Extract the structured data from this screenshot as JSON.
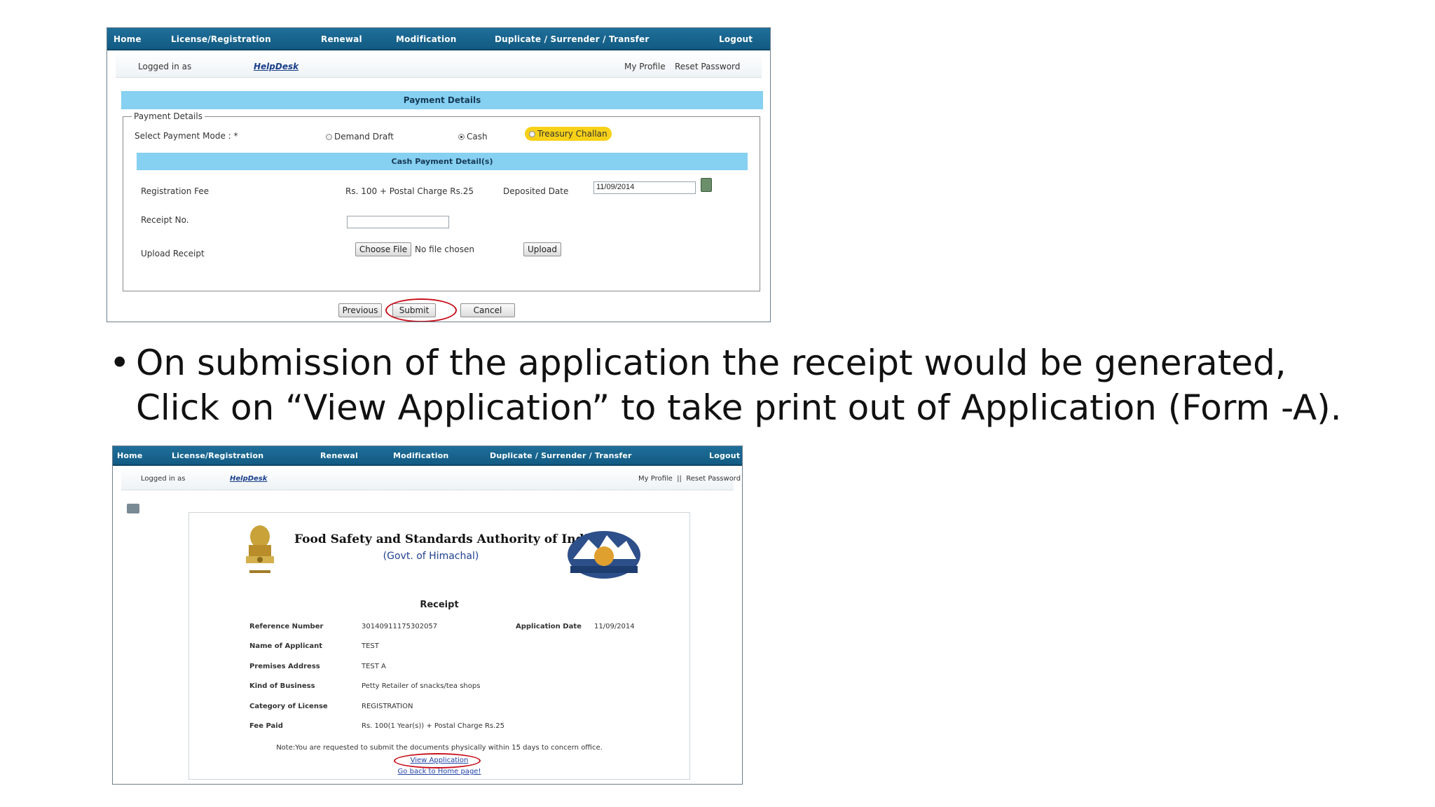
{
  "nav": {
    "home": "Home",
    "license": "License/Registration",
    "renewal": "Renewal",
    "modification": "Modification",
    "duplicate": "Duplicate / Surrender / Transfer",
    "logout": "Logout"
  },
  "login": {
    "logged_in_as": "Logged in as",
    "user": "HelpDesk",
    "my_profile": "My Profile",
    "reset_password": "Reset Password",
    "profile_links": "My Profile  ||  Reset Password"
  },
  "payment": {
    "section_title": "Payment Details",
    "legend": "Payment Details",
    "mode_label": "Select Payment Mode : *",
    "modes": [
      "Demand Draft",
      "Cash",
      "Treasury Challan"
    ],
    "selected_mode": "Cash",
    "highlighted_mode": "Treasury Challan",
    "cash_header": "Cash Payment Detail(s)",
    "fee_label": "Registration Fee",
    "fee_value": "Rs. 100 + Postal Charge Rs.25",
    "deposited_label": "Deposited Date",
    "deposited_value": "11/09/2014",
    "receipt_no_label": "Receipt No.",
    "receipt_no_value": "",
    "upload_label": "Upload Receipt",
    "choose_file": "Choose File",
    "no_file": "No file chosen",
    "upload_button": "Upload",
    "previous_button": "Previous",
    "submit_button": "Submit",
    "cancel_button": "Cancel"
  },
  "bullet": {
    "line1": "On submission of the application the receipt would be generated,",
    "line2": "Click on “View Application” to take print out of Application (Form -A)."
  },
  "receipt": {
    "org_title": "Food Safety and Standards Authority of India",
    "org_sub": "(Govt. of Himachal)",
    "heading": "Receipt",
    "reference_label": "Reference Number",
    "reference_value": "30140911175302057",
    "app_date_label": "Application Date",
    "app_date_value": "11/09/2014",
    "applicant_label": "Name of Applicant",
    "applicant_value": "TEST",
    "premises_label": "Premises Address",
    "premises_value": "TEST A",
    "business_label": "Kind of Business",
    "business_value": "Petty Retailer of snacks/tea shops",
    "category_label": "Category of License",
    "category_value": "REGISTRATION",
    "fee_label": "Fee Paid",
    "fee_value": "Rs. 100(1 Year(s)) + Postal Charge Rs.25",
    "note": "Note:You are requested to submit the documents physically within 15 days to concern office.",
    "view_link": "View Application",
    "home_link": "Go back to Home page!"
  },
  "colors": {
    "nav_bg": "#1a6891",
    "section_header": "#86d0f2",
    "highlight": "#f7d117",
    "annotation": "#c8101c"
  }
}
